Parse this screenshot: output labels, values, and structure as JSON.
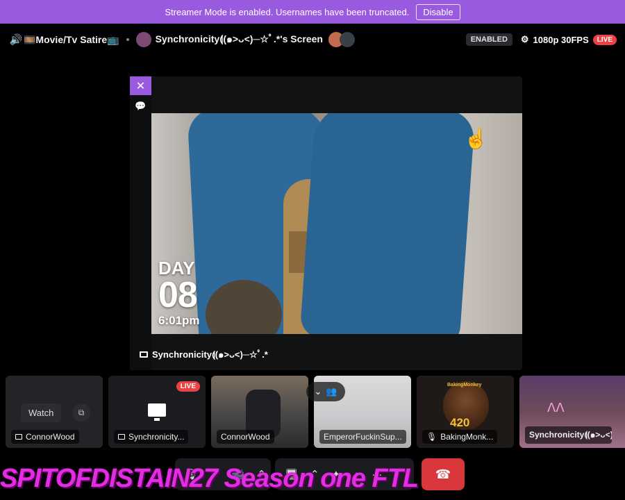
{
  "banner": {
    "text": "Streamer Mode is enabled. Usernames have been truncated.",
    "button": "Disable"
  },
  "header": {
    "channel_icon": "speaker-icon",
    "channel": "🎞️Movie/Tv Satire📺",
    "stream_title": "Synchronicity⟬(๑˃ᴗ˂)─☆ﾟ.*'s Screen",
    "badge_enabled": "ENABLED",
    "quality": "1080p 30FPS",
    "live": "LIVE"
  },
  "viewer": {
    "overlay_day": "DAY",
    "overlay_num": "08",
    "overlay_time": "6:01pm",
    "streamer_name": "Synchronicity⟬(๑>ᴗ<)─☆ﾟ.*"
  },
  "participants": [
    {
      "name": "ConnorWood",
      "watch_label": "Watch"
    },
    {
      "name": "Synchronicity...",
      "badge": "LIVE"
    },
    {
      "name": "ConnorWood"
    },
    {
      "name": "EmperorFuckinSup..."
    },
    {
      "name": "BakingMonk...",
      "logo_num": "420",
      "logo_brand": "BakingMonkey"
    },
    {
      "name": "Synchronicity⟬(๑>ᴗ<)"
    }
  ],
  "controls": {
    "more": "···"
  },
  "watermark": "SPITOFDISTAIN27 Season one FTL",
  "colors": {
    "accent": "#9a5ae0",
    "live": "#ed4245",
    "hangup": "#da373c",
    "watermark": "#e02ee0"
  }
}
